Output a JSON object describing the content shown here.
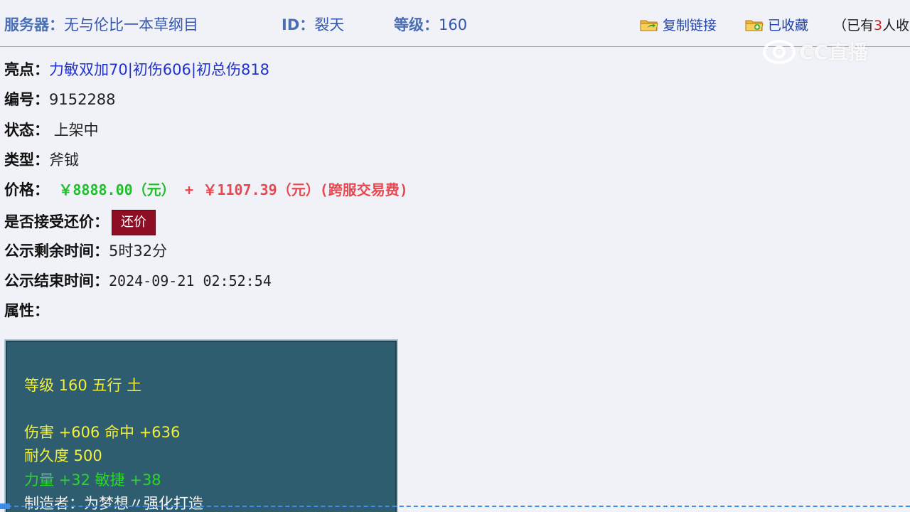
{
  "header": {
    "server_label": "服务器：",
    "server_value": "无与伦比一本草纲目",
    "id_label": "ID：",
    "id_value": "裂天",
    "level_label": "等级：",
    "level_value": "160",
    "copy_link": "复制链接",
    "favorited": "已收藏",
    "collect_prefix": "（已有",
    "collect_count": "3",
    "collect_suffix": "人收"
  },
  "watermark": "CC直播",
  "rows": {
    "highlight_label": "亮点：",
    "highlight_value": "力敏双加70|初伤606|初总伤818",
    "serial_label": "编号：",
    "serial_value": "9152288",
    "status_label": "状态：",
    "status_value": "上架中",
    "type_label": "类型：",
    "type_value": "斧钺",
    "price_label": "价格：",
    "price_main": "￥8888.00（元）",
    "price_plus": "+",
    "price_fee": "￥1107.39（元）(跨服交易费)",
    "counter_label": "是否接受还价：",
    "counter_button": "还价",
    "remaining_label": "公示剩余时间：",
    "remaining_value": "5时32分",
    "end_label": "公示结束时间：",
    "end_value": "2024-09-21 02:52:54",
    "attr_label": "属性："
  },
  "attributes": {
    "line1": "等级 160 五行 土",
    "line2": "伤害 +606 命中 +636",
    "line3": "耐久度 500",
    "line4": "力量 +32 敏捷 +38",
    "line5": "制造者：为梦想〃强化打造"
  },
  "colors": {
    "background": "#f1f2f8",
    "price_green": "#1fbf2c",
    "price_red": "#e8484f",
    "counter_button": "#8e0f24",
    "attr_panel": "#2f5d70",
    "attr_yellow": "#f2ee3a",
    "attr_green": "#2bd62b"
  },
  "icons": {
    "copy": "folder-arrow-icon",
    "favorite": "folder-plus-icon"
  }
}
